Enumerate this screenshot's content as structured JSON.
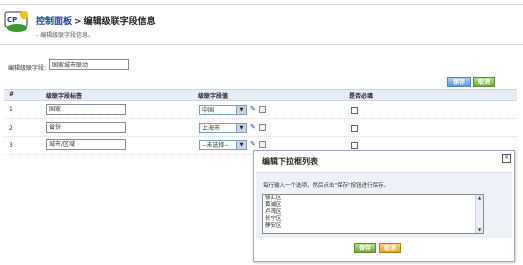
{
  "header": {
    "breadcrumb_root": "控制面板",
    "separator": ">",
    "breadcrumb_current": "编辑级联字段信息",
    "subtitle": "- 编辑级联字段信息。",
    "logo_text": "CP"
  },
  "form": {
    "field_label": "编辑级联字段:",
    "field_value": "国家城市联动"
  },
  "toolbar": {
    "save_label": "保存",
    "cancel_label": "取消"
  },
  "table": {
    "headers": [
      "#",
      "级联字段标签",
      "级联字段值",
      "是否必填"
    ],
    "rows": [
      {
        "num": "1",
        "label": "国家",
        "value": "中国"
      },
      {
        "num": "2",
        "label": "省份",
        "value": "上海市"
      },
      {
        "num": "3",
        "label": "城市/区域",
        "value": "--未选择--"
      }
    ]
  },
  "modal": {
    "title": "编辑下拉框列表",
    "close_glyph": "×",
    "hint": "每行输入一个选项，然后点击\"保存\"按钮进行保存。",
    "options": [
      "徐汇区",
      "黄浦区",
      "卢湾区",
      "长宁区",
      "静安区"
    ],
    "save_label": "保存",
    "cancel_label": "取消"
  }
}
